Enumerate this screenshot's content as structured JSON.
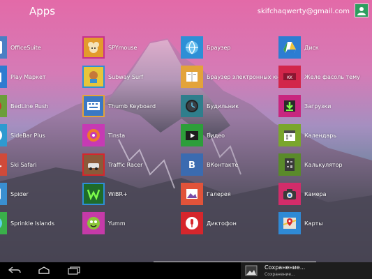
{
  "header": {
    "title": "Apps",
    "account": "skifchaqwerty@gmail.com"
  },
  "columns": [
    {
      "apps": [
        {
          "label": "OfficeSuite",
          "icon": "officesuite-icon",
          "color": "#4a7fc4"
        },
        {
          "label": "Play Маркет",
          "icon": "play-store-icon",
          "color": "#2e7bd0"
        },
        {
          "label": "BedLine Rush",
          "icon": "bedline-rush-icon",
          "color": "#6b9e3a"
        },
        {
          "label": "SideBar Plus",
          "icon": "sidebar-plus-icon",
          "color": "#2e9ad0"
        },
        {
          "label": "Ski Safari",
          "icon": "ski-safari-icon",
          "color": "#d04a3a"
        },
        {
          "label": "Spider",
          "icon": "spider-icon",
          "color": "#3a8fd0"
        },
        {
          "label": "Sprinkle Islands",
          "icon": "sprinkle-islands-icon",
          "color": "#3ab04a"
        }
      ]
    },
    {
      "apps": [
        {
          "label": "SPYmouse",
          "icon": "spymouse-icon",
          "color": "#e39b2c"
        },
        {
          "label": "Subway Surf",
          "icon": "subway-surf-icon",
          "color": "#e7c53a"
        },
        {
          "label": "Thumb Keyboard",
          "icon": "thumb-keyboard-icon",
          "color": "#3a78c4"
        },
        {
          "label": "Tinsta",
          "icon": "tinsta-icon",
          "color": "#c63ab4"
        },
        {
          "label": "Traffic Racer",
          "icon": "traffic-racer-icon",
          "color": "#8a5a3a"
        },
        {
          "label": "WiBR+",
          "icon": "wibr-icon",
          "color": "#1f6b2a"
        },
        {
          "label": "Yumm",
          "icon": "yumm-icon",
          "color": "#c53aa8"
        }
      ]
    },
    {
      "apps": [
        {
          "label": "Браузер",
          "icon": "browser-icon",
          "color": "#2e8fd6"
        },
        {
          "label": "Браузер электронных книг",
          "icon": "ebook-browser-icon",
          "color": "#e3a33a"
        },
        {
          "label": "Будильник",
          "icon": "alarm-clock-icon",
          "color": "#2f7e8c"
        },
        {
          "label": "Видео",
          "icon": "video-icon",
          "color": "#2d9e3a"
        },
        {
          "label": "ВКонтакте",
          "icon": "vkontakte-icon",
          "color": "#3b6bb0"
        },
        {
          "label": "Галерея",
          "icon": "gallery-icon",
          "color": "#e1533a"
        },
        {
          "label": "Диктофон",
          "icon": "recorder-icon",
          "color": "#d6262c"
        }
      ]
    },
    {
      "apps": [
        {
          "label": "Диск",
          "icon": "drive-icon",
          "color": "#2d7dd2"
        },
        {
          "label": "Желе фасоль тему",
          "icon": "jelly-bean-theme-icon",
          "color": "#d2264a"
        },
        {
          "label": "Загрузки",
          "icon": "downloads-icon",
          "color": "#c8267f"
        },
        {
          "label": "Календарь",
          "icon": "calendar-icon",
          "color": "#7aa62c"
        },
        {
          "label": "Калькулятор",
          "icon": "calculator-icon",
          "color": "#5a8a2a"
        },
        {
          "label": "Камера",
          "icon": "camera-icon",
          "color": "#d22c6a"
        },
        {
          "label": "Карты",
          "icon": "maps-icon",
          "color": "#2f8ad6"
        }
      ]
    }
  ],
  "nav": {
    "back": "back-icon",
    "home": "home-icon",
    "recents": "recents-icon"
  },
  "notification": {
    "title": "Сохранение...",
    "subtitle": "Сохранение..."
  }
}
